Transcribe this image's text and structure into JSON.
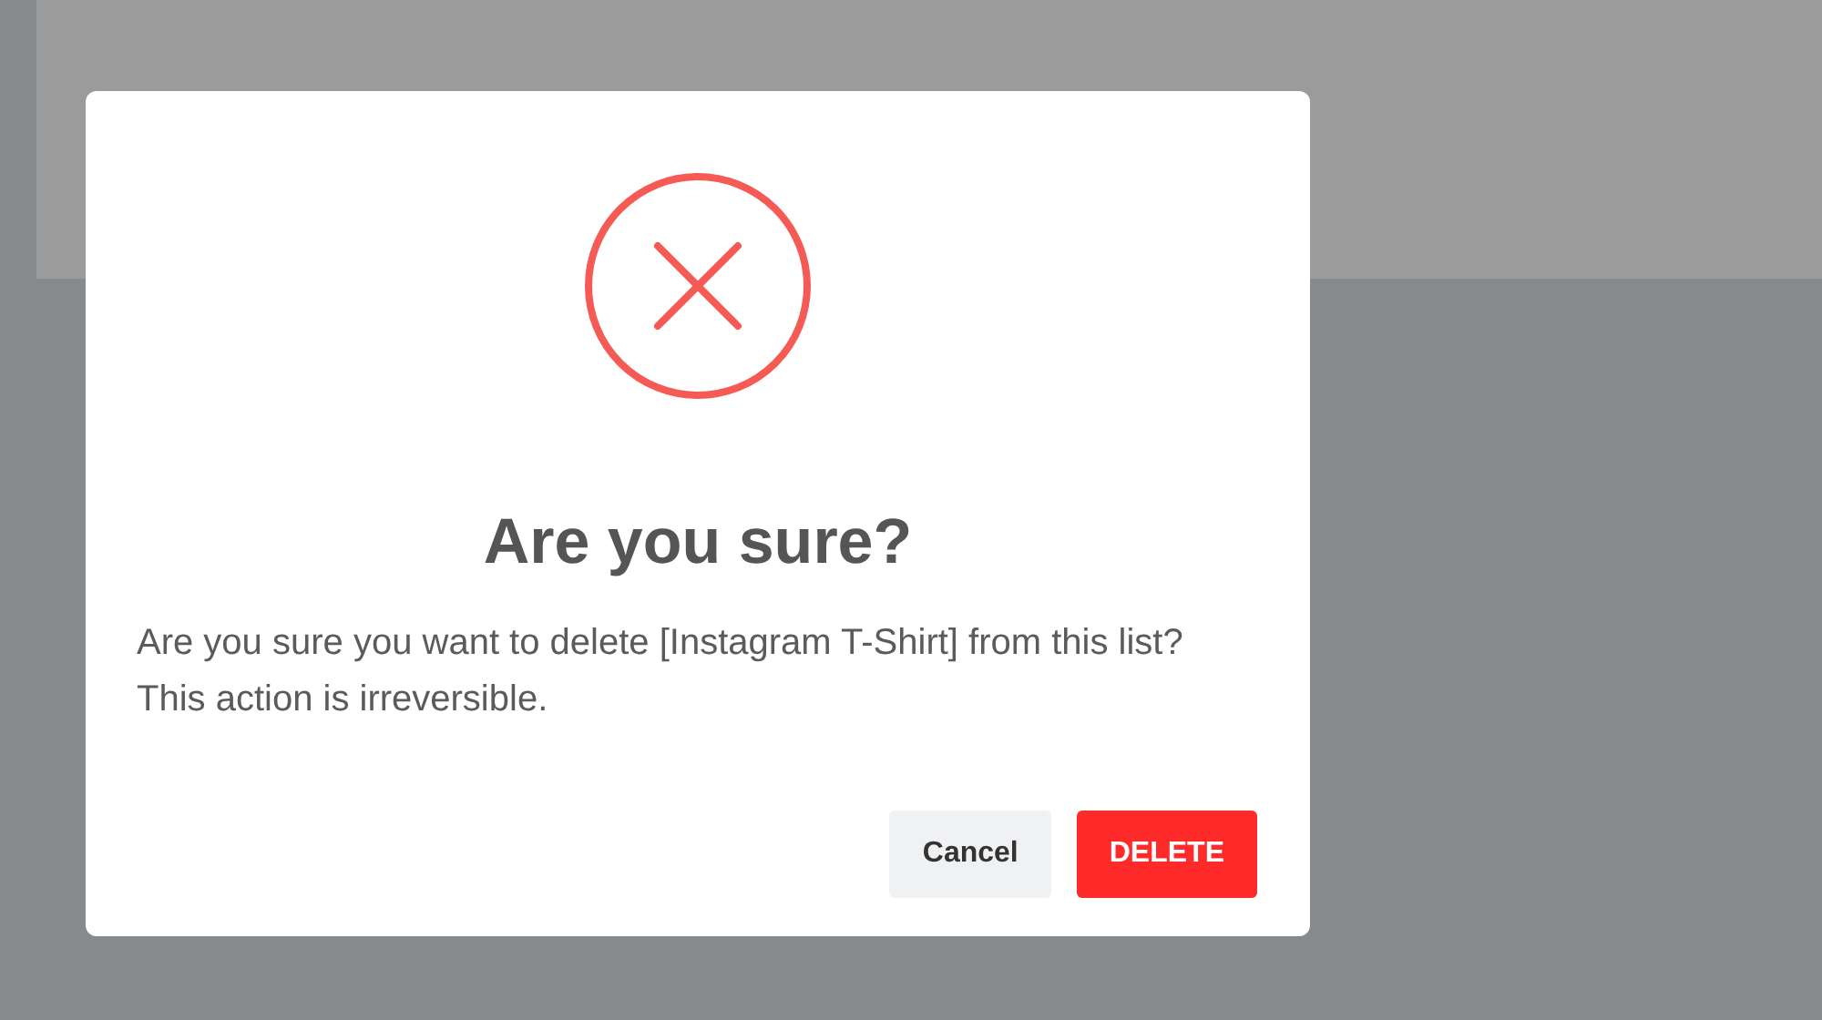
{
  "dialog": {
    "title": "Are you sure?",
    "message": "Are you sure you want to delete [Instagram T-Shirt] from this list? This action is irreversible.",
    "buttons": [
      {
        "label": "Cancel",
        "kind": "secondary"
      },
      {
        "label": "DELETE",
        "kind": "danger"
      }
    ]
  }
}
